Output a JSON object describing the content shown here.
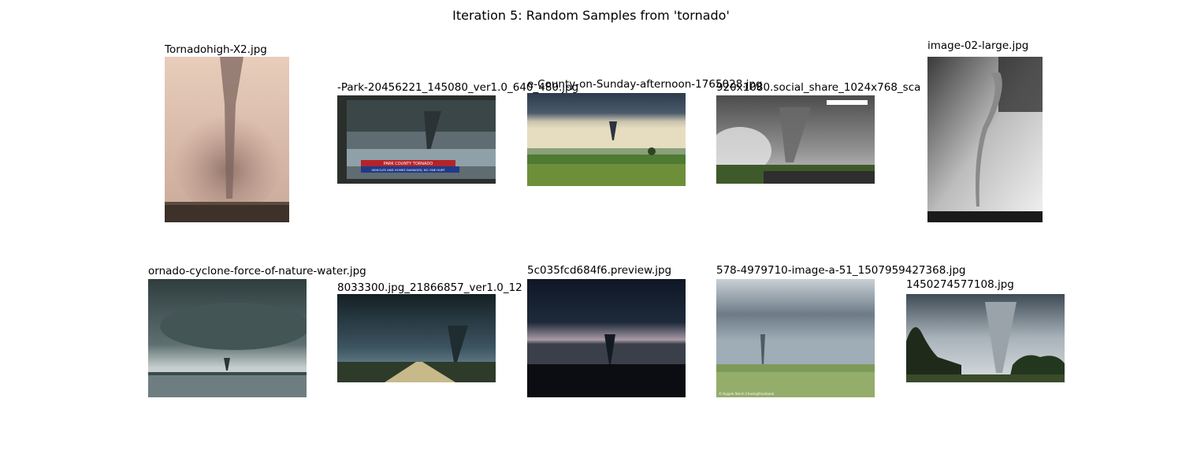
{
  "figure": {
    "title": "Iteration 5: Random Samples from 'tornado'"
  },
  "samples": [
    {
      "filename": "Tornadohigh-X2.jpg",
      "overlay_text": ""
    },
    {
      "filename": "-Park-20456221_145080_ver1.0_640_480.jpg",
      "overlay_text": "PARK COUNTY TORNADO",
      "overlay_subtext": "VEHICLES AND HOMES DAMAGED, NO ONE HURT"
    },
    {
      "filename": "e-County-on-Sunday-afternoon-1765028.jpg",
      "overlay_text": ""
    },
    {
      "filename": "920x1080.social_share_1024x768_sca",
      "overlay_text": ""
    },
    {
      "filename": "image-02-large.jpg",
      "overlay_text": ""
    },
    {
      "filename": "ornado-cyclone-force-of-nature-water.jpg",
      "overlay_text": ""
    },
    {
      "filename": "8033300.jpg_21866857_ver1.0_12",
      "overlay_text": ""
    },
    {
      "filename": "5c035fcd684f6.preview.jpg",
      "overlay_text": ""
    },
    {
      "filename": "578-4979710-image-a-51_1507959427368.jpg",
      "overlay_text": "© Hypple Storm Chasing/Facebook"
    },
    {
      "filename": "1450274577108.jpg",
      "overlay_text": ""
    }
  ],
  "colors": {
    "background": "#ffffff",
    "text": "#000000"
  }
}
